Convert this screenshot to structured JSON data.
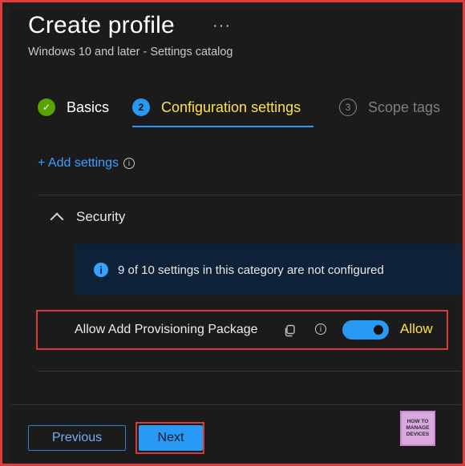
{
  "header": {
    "title": "Create profile",
    "more_glyph": "···",
    "subtitle": "Windows 10 and later - Settings catalog"
  },
  "steps": [
    {
      "number": "✓",
      "label": "Basics",
      "state": "complete"
    },
    {
      "number": "2",
      "label": "Configuration settings",
      "state": "current"
    },
    {
      "number": "3",
      "label": "Scope tags",
      "state": "upcoming"
    }
  ],
  "add_settings": {
    "label": "+ Add settings",
    "info_glyph": "i"
  },
  "category": {
    "name": "Security",
    "expanded": true
  },
  "info_bar": {
    "glyph": "i",
    "text": "9 of 10 settings in this category are not configured"
  },
  "setting": {
    "name": "Allow Add Provisioning Package",
    "toggle_state": "on",
    "toggle_label": "Allow",
    "info_glyph": "i"
  },
  "footer": {
    "previous_label": "Previous",
    "next_label": "Next",
    "logo_lines": [
      "HOW TO",
      "MANAGE",
      "DEVICES"
    ]
  },
  "colors": {
    "accent": "#2899f5",
    "highlight_text": "#ffe14a",
    "annotation_border": "#d83a3a",
    "success": "#57a300",
    "background": "#1b1b1b"
  },
  "icons": {
    "more": "more-horizontal-icon",
    "basics_step": "checkmark-circle-icon",
    "add_settings_info": "info-outline-icon",
    "category_toggle": "chevron-up-icon",
    "info_bar": "info-solid-icon",
    "setting_copy": "copy-icon",
    "setting_info": "info-outline-icon"
  }
}
